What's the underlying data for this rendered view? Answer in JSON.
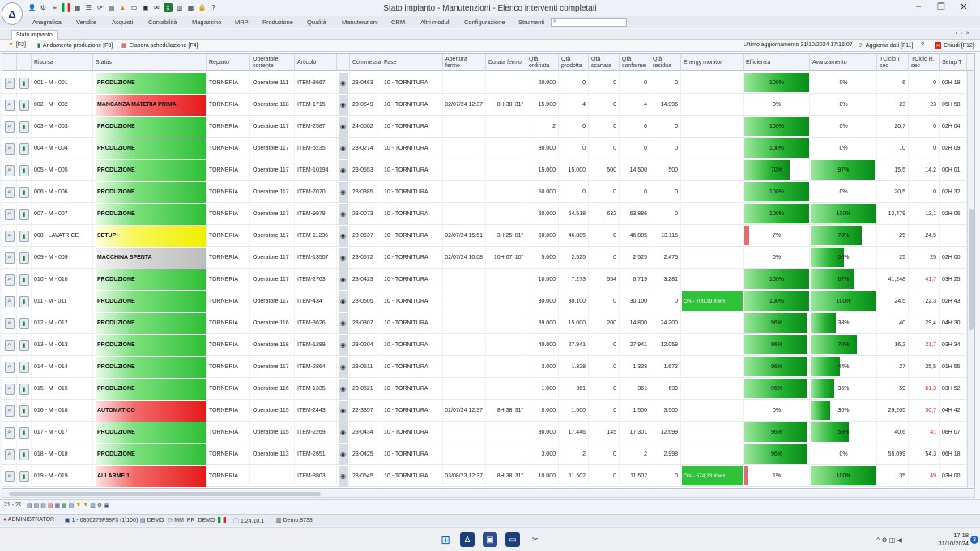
{
  "window": {
    "title": "Stato impianto - Manutenzioni - Elenco interventi completati",
    "logo": "Δ"
  },
  "menu": [
    "Anagrafica",
    "Vendite",
    "Acquisti",
    "Contabilità",
    "Magazzino",
    "MRP",
    "Produzione",
    "Qualità",
    "Manutenzioni",
    "CRM",
    "Altri moduli",
    "Configurazione",
    "Strumenti"
  ],
  "tab": "Stato impianto",
  "toolbar": {
    "filter": "[F2]",
    "andamento": "Andamento produzione [F3]",
    "schedula": "Elabora schedulazione [F4]",
    "ultimo": "Ultimo aggiornamento 31/10/2024 17:16:07",
    "aggiorna": "Aggiorna dati [F11]",
    "chiudi": "Chiudi [F12]"
  },
  "headers": {
    "risorsa": "Risorsa",
    "status": "Status",
    "reparto": "Reparto",
    "operatore": "Operatore corrente",
    "articolo": "Articolo",
    "commessa": "Commessa",
    "fase": "Fase",
    "apertura": "Apertura fermo",
    "durata": "Durata fermo",
    "qord": "Qtà ordinata",
    "qprod": "Qtà prodotta",
    "qscart": "Qtà scartata",
    "qconf": "Qtà conforme",
    "qres": "Qtà residua",
    "energy": "Energy monitor",
    "eff": "Efficienza",
    "avanz": "Avanzamento",
    "tciclot": "TCiclo T sec",
    "tcicloR": "TCiclo R. sec",
    "setup": "Setup T"
  },
  "colors": {
    "green": "#2fc23a",
    "red": "#ee1d23",
    "yellow": "#f2f20a",
    "gray": "#bdbdbd",
    "darkgreen": "#0b8a1a"
  },
  "rows": [
    {
      "risorsa": "001 - M - 001",
      "status": "PRODUZIONE",
      "st": "green",
      "reparto": "TORNERIA",
      "operatore": "Operatore 111",
      "articolo": "ITEM-8667",
      "commessa": "23-0463",
      "fase": "10  - TORNITURA",
      "apertura": "",
      "durata": "",
      "qord": "20.000",
      "qprod": "0",
      "qscart": "0",
      "qconf": "0",
      "qres": "0",
      "energy": "",
      "eff": "100%",
      "effv": 1.0,
      "avz": "0%",
      "avzv": 0.0,
      "tct": "6",
      "tcr": "0",
      "tcrRed": false,
      "setup": "02H 19"
    },
    {
      "risorsa": "002 - M - 002",
      "status": "MANCANZA MATERIA PRIMA",
      "st": "red",
      "reparto": "TORNERIA",
      "operatore": "Operatore 118",
      "articolo": "ITEM-1715",
      "commessa": "23-0549",
      "fase": "10  - TORNITURA",
      "apertura": "02/07/24 12:37",
      "durata": "8H 38' 31\"",
      "qord": "15.000",
      "qprod": "4",
      "qscart": "0",
      "qconf": "4",
      "qres": "14.996",
      "energy": "",
      "eff": "0%",
      "effv": 0.0,
      "avz": "0%",
      "avzv": 0.0,
      "tct": "23",
      "tcr": "23",
      "tcrRed": false,
      "setup": "05H 58"
    },
    {
      "risorsa": "003 - M - 003",
      "status": "PRODUZIONE",
      "st": "green",
      "reparto": "TORNERIA",
      "operatore": "Operatore 117",
      "articolo": "ITEM-2587",
      "commessa": "24-0002",
      "fase": "10  - TORNITURA",
      "apertura": "",
      "durata": "",
      "qord": "2",
      "qprod": "0",
      "qscart": "0",
      "qconf": "0",
      "qres": "0",
      "energy": "",
      "eff": "100%",
      "effv": 1.0,
      "avz": "0%",
      "avzv": 0.0,
      "tct": "20,7",
      "tcr": "0",
      "tcrRed": false,
      "setup": "02H 04"
    },
    {
      "risorsa": "004 - M - 004",
      "status": "PRODUZIONE",
      "st": "green",
      "reparto": "TORNERIA",
      "operatore": "Operatore 117",
      "articolo": "ITEM-5235",
      "commessa": "23-0274",
      "fase": "10  - TORNITURA",
      "apertura": "",
      "durata": "",
      "qord": "30.000",
      "qprod": "0",
      "qscart": "0",
      "qconf": "0",
      "qres": "0",
      "energy": "",
      "eff": "100%",
      "effv": 1.0,
      "avz": "0%",
      "avzv": 0.0,
      "tct": "10",
      "tcr": "0",
      "tcrRed": false,
      "setup": "02H 09"
    },
    {
      "risorsa": "005 - M - 005",
      "status": "PRODUZIONE",
      "st": "green",
      "reparto": "TORNERIA",
      "operatore": "Operatore 117",
      "articolo": "ITEM-10194",
      "commessa": "23-0553",
      "fase": "10  - TORNITURA",
      "apertura": "",
      "durata": "",
      "qord": "15.000",
      "qprod": "15.000",
      "qscart": "500",
      "qconf": "14.500",
      "qres": "500",
      "energy": "",
      "eff": "70%",
      "effv": 0.7,
      "avz": "97%",
      "avzv": 0.97,
      "tct": "15,5",
      "tcr": "14,2",
      "tcrRed": false,
      "setup": "00H 01"
    },
    {
      "risorsa": "006 - M - 006",
      "status": "PRODUZIONE",
      "st": "green",
      "reparto": "TORNERIA",
      "operatore": "Operatore 117",
      "articolo": "ITEM-7070",
      "commessa": "23-0385",
      "fase": "10  - TORNITURA",
      "apertura": "",
      "durata": "",
      "qord": "50.000",
      "qprod": "0",
      "qscart": "0",
      "qconf": "0",
      "qres": "0",
      "energy": "",
      "eff": "100%",
      "effv": 1.0,
      "avz": "0%",
      "avzv": 0.0,
      "tct": "20,5",
      "tcr": "0",
      "tcrRed": false,
      "setup": "02H 32"
    },
    {
      "risorsa": "007 - M - 007",
      "status": "PRODUZIONE",
      "st": "green",
      "reparto": "TORNERIA",
      "operatore": "Operatore 117",
      "articolo": "ITEM-9979",
      "commessa": "23-0073",
      "fase": "10  - TORNITURA",
      "apertura": "",
      "durata": "",
      "qord": "60.000",
      "qprod": "64.518",
      "qscart": "632",
      "qconf": "63.886",
      "qres": "0",
      "energy": "",
      "eff": "100%",
      "effv": 1.0,
      "avz": "100%",
      "avzv": 1.0,
      "tct": "12,479",
      "tcr": "12,1",
      "tcrRed": false,
      "setup": "02H 06"
    },
    {
      "risorsa": "008 - LAVATRICE",
      "status": "SETUP",
      "st": "yellow",
      "reparto": "TORNERIA",
      "operatore": "Operatore 117",
      "articolo": "ITEM-11236",
      "commessa": "23-0537",
      "fase": "10  - TORNITURA",
      "apertura": "02/07/24 15:51",
      "durata": "3H 25' 01\"",
      "qord": "60.000",
      "qprod": "46.885",
      "qscart": "0",
      "qconf": "46.885",
      "qres": "13.115",
      "energy": "",
      "eff": "7%",
      "effv": 0.07,
      "avz": "78%",
      "avzv": 0.78,
      "tct": "25",
      "tcr": "24,5",
      "tcrRed": false,
      "setup": ""
    },
    {
      "risorsa": "009 - M - 009",
      "status": "MACCHINA SPENTA",
      "st": "gray",
      "reparto": "TORNERIA",
      "operatore": "Operatore 117",
      "articolo": "ITEM-13507",
      "commessa": "23-0572",
      "fase": "10  - TORNITURA",
      "apertura": "02/07/24 10:08",
      "durata": "10H 07' 10\"",
      "qord": "5.000",
      "qprod": "2.525",
      "qscart": "0",
      "qconf": "2.525",
      "qres": "2.475",
      "energy": "",
      "eff": "0%",
      "effv": 0.0,
      "avz": "50%",
      "avzv": 0.5,
      "tct": "25",
      "tcr": "25",
      "tcrRed": false,
      "setup": "02H 00"
    },
    {
      "risorsa": "010 - M - 010",
      "status": "PRODUZIONE",
      "st": "green",
      "reparto": "TORNERIA",
      "operatore": "Operatore 117",
      "articolo": "ITEM-2763",
      "commessa": "23-0423",
      "fase": "10  - TORNITURA",
      "apertura": "",
      "durata": "",
      "qord": "10.000",
      "qprod": "7.273",
      "qscart": "554",
      "qconf": "6.719",
      "qres": "3.281",
      "energy": "",
      "eff": "100%",
      "effv": 1.0,
      "avz": "67%",
      "avzv": 0.67,
      "tct": "41,248",
      "tcr": "41,7",
      "tcrRed": true,
      "setup": "03H 25"
    },
    {
      "risorsa": "011 - M - 011",
      "status": "PRODUZIONE",
      "st": "green",
      "reparto": "TORNERIA",
      "operatore": "Operatore 117",
      "articolo": "ITEM-434",
      "commessa": "23-0505",
      "fase": "10  - TORNITURA",
      "apertura": "",
      "durata": "",
      "qord": "30.000",
      "qprod": "30.100",
      "qscart": "0",
      "qconf": "30.100",
      "qres": "0",
      "energy": "ON - 700,19 KwH",
      "eff": "100%",
      "effv": 1.0,
      "avz": "100%",
      "avzv": 1.0,
      "tct": "24,5",
      "tcr": "22,3",
      "tcrRed": false,
      "setup": "02H 43"
    },
    {
      "risorsa": "012 - M - 012",
      "status": "PRODUZIONE",
      "st": "green",
      "reparto": "TORNERIA",
      "operatore": "Operatore 116",
      "articolo": "ITEM-3626",
      "commessa": "23-0307",
      "fase": "10  - TORNITURA",
      "apertura": "",
      "durata": "",
      "qord": "39.000",
      "qprod": "15.000",
      "qscart": "200",
      "qconf": "14.800",
      "qres": "24.200",
      "energy": "",
      "eff": "96%",
      "effv": 0.96,
      "avz": "38%",
      "avzv": 0.38,
      "tct": "40",
      "tcr": "29,4",
      "tcrRed": false,
      "setup": "04H 30"
    },
    {
      "risorsa": "013 - M - 013",
      "status": "PRODUZIONE",
      "st": "green",
      "reparto": "TORNERIA",
      "operatore": "Operatore 118",
      "articolo": "ITEM-1289",
      "commessa": "23-0204",
      "fase": "10  - TORNITURA",
      "apertura": "",
      "durata": "",
      "qord": "40.000",
      "qprod": "27.941",
      "qscart": "0",
      "qconf": "27.941",
      "qres": "12.059",
      "energy": "",
      "eff": "96%",
      "effv": 0.96,
      "avz": "70%",
      "avzv": 0.7,
      "tct": "16,2",
      "tcr": "21,7",
      "tcrRed": true,
      "setup": "03H 34"
    },
    {
      "risorsa": "014 - M - 014",
      "status": "PRODUZIONE",
      "st": "green",
      "reparto": "TORNERIA",
      "operatore": "Operatore 117",
      "articolo": "ITEM-2864",
      "commessa": "23-0511",
      "fase": "10  - TORNITURA",
      "apertura": "",
      "durata": "",
      "qord": "3.000",
      "qprod": "1.328",
      "qscart": "0",
      "qconf": "1.328",
      "qres": "1.672",
      "energy": "",
      "eff": "96%",
      "effv": 0.96,
      "avz": "44%",
      "avzv": 0.44,
      "tct": "27",
      "tcr": "25,5",
      "tcrRed": false,
      "setup": "01H 55"
    },
    {
      "risorsa": "015 - M - 015",
      "status": "PRODUZIONE",
      "st": "green",
      "reparto": "TORNERIA",
      "operatore": "Operatore 116",
      "articolo": "ITEM-1335",
      "commessa": "23-0521",
      "fase": "10  - TORNITURA",
      "apertura": "",
      "durata": "",
      "qord": "1.000",
      "qprod": "361",
      "qscart": "0",
      "qconf": "361",
      "qres": "639",
      "energy": "",
      "eff": "96%",
      "effv": 0.96,
      "avz": "36%",
      "avzv": 0.36,
      "tct": "59",
      "tcr": "61,3",
      "tcrRed": true,
      "setup": "03H 52"
    },
    {
      "risorsa": "016 - M - 016",
      "status": "AUTOMATICO",
      "st": "red",
      "reparto": "TORNERIA",
      "operatore": "Operatore 115",
      "articolo": "ITEM-2443",
      "commessa": "22-3357",
      "fase": "10  - TORNITURA",
      "apertura": "02/07/24 12:37",
      "durata": "8H 38' 31\"",
      "qord": "5.000",
      "qprod": "1.500",
      "qscart": "0",
      "qconf": "1.500",
      "qres": "3.500",
      "energy": "",
      "eff": "0%",
      "effv": 0.0,
      "avz": "30%",
      "avzv": 0.3,
      "tct": "29,205",
      "tcr": "50,7",
      "tcrRed": true,
      "setup": "04H 42"
    },
    {
      "risorsa": "017 - M - 017",
      "status": "PRODUZIONE",
      "st": "green",
      "reparto": "TORNERIA",
      "operatore": "Operatore 115",
      "articolo": "ITEM-2269",
      "commessa": "23-0434",
      "fase": "10  - TORNITURA",
      "apertura": "",
      "durata": "",
      "qord": "30.000",
      "qprod": "17.446",
      "qscart": "145",
      "qconf": "17.301",
      "qres": "12.699",
      "energy": "",
      "eff": "96%",
      "effv": 0.96,
      "avz": "58%",
      "avzv": 0.58,
      "tct": "40,6",
      "tcr": "41",
      "tcrRed": true,
      "setup": "08H 07"
    },
    {
      "risorsa": "018 - M - 018",
      "status": "PRODUZIONE",
      "st": "green",
      "reparto": "TORNERIA",
      "operatore": "Operatore 113",
      "articolo": "ITEM-2651",
      "commessa": "23-0425",
      "fase": "10  - TORNITURA",
      "apertura": "",
      "durata": "",
      "qord": "3.000",
      "qprod": "2",
      "qscart": "0",
      "qconf": "2",
      "qres": "2.998",
      "energy": "",
      "eff": "96%",
      "effv": 0.96,
      "avz": "0%",
      "avzv": 0.0,
      "tct": "55,099",
      "tcr": "54,3",
      "tcrRed": false,
      "setup": "06H 18"
    },
    {
      "risorsa": "019 - M - 019",
      "status": "ALLARME 1",
      "st": "red",
      "reparto": "TORNERIA",
      "operatore": "",
      "articolo": "ITEM-8803",
      "commessa": "23-0545",
      "fase": "10  - TORNITURA",
      "apertura": "03/08/23 12:37",
      "durata": "8H 38' 31\"",
      "qord": "10.000",
      "qprod": "11.502",
      "qscart": "0",
      "qconf": "11.502",
      "qres": "0",
      "energy": "ON - 574,23 KwH",
      "eff": "1%",
      "effv": 0.01,
      "avz": "100%",
      "avzv": 1.0,
      "tct": "35",
      "tcr": "49",
      "tcrRed": true,
      "setup": "03H 00"
    }
  ],
  "footer": {
    "count": "21 - 21"
  },
  "statusbar": {
    "user": "ADMINISTRATOR",
    "session": "1 - 0800279F98F3 (1\\100)",
    "db": "DEMO",
    "profile": "MM_PR_DEMO",
    "version": "1.24.10.1",
    "server": "Demo:8733"
  },
  "taskbar": {
    "time": "17:18",
    "date": "31/10/2024",
    "badge": "3"
  }
}
